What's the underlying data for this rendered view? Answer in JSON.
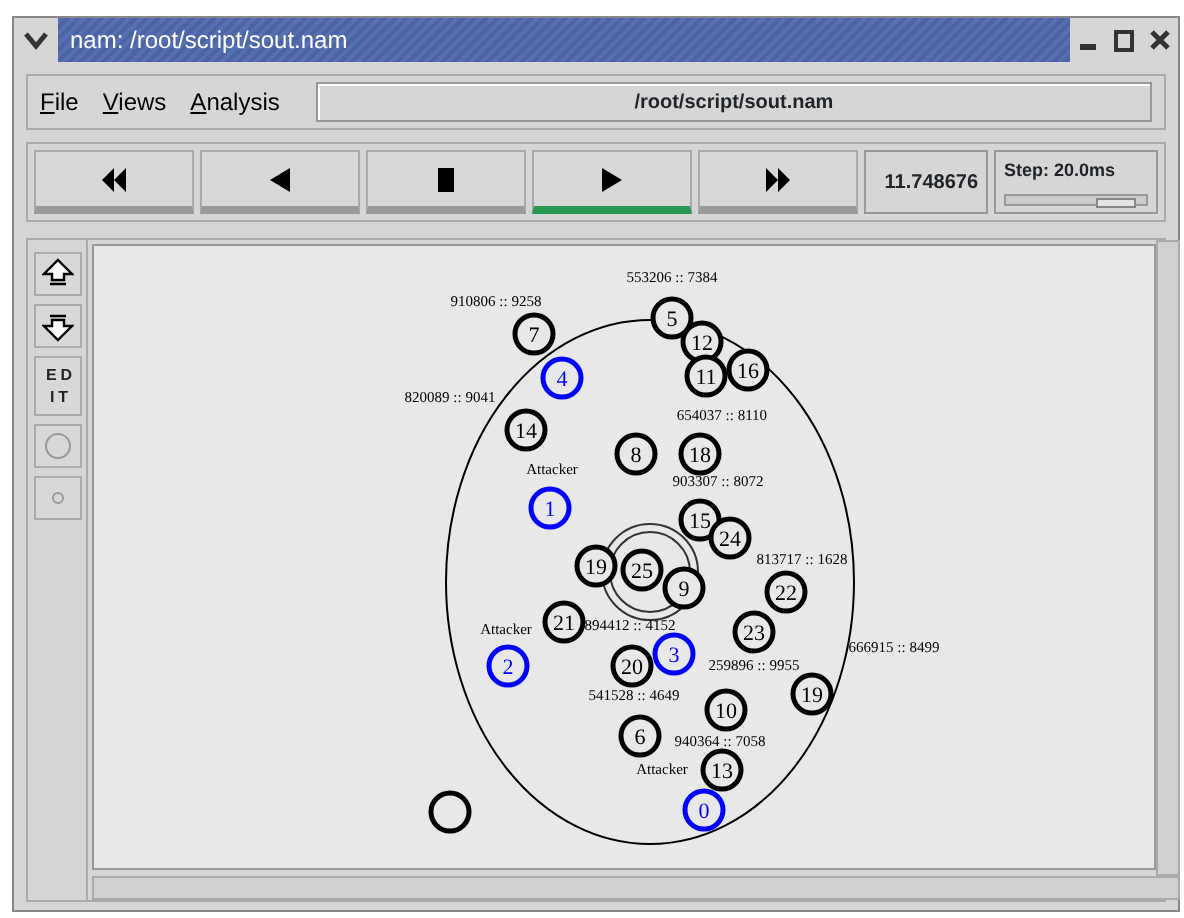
{
  "window": {
    "title": "nam: /root/script/sout.nam"
  },
  "menu": [
    "File",
    "Views",
    "Analysis"
  ],
  "path": "/root/script/sout.nam",
  "controls": [
    {
      "kind": "rewind",
      "selected": false
    },
    {
      "kind": "back",
      "selected": false
    },
    {
      "kind": "stop",
      "selected": false
    },
    {
      "kind": "play",
      "selected": true
    },
    {
      "kind": "forward",
      "selected": false
    }
  ],
  "time": "11.748676",
  "step": {
    "label": "Step: 20.0ms",
    "level": 0.78
  },
  "tools": [
    {
      "kind": "zoom-in"
    },
    {
      "kind": "zoom-out"
    },
    {
      "kind": "edit",
      "label": "EDIT"
    },
    {
      "kind": "circle"
    },
    {
      "kind": "dot"
    }
  ],
  "network": {
    "nodes": [
      {
        "label": "5",
        "color": "#000000"
      },
      {
        "label": "7",
        "color": "#000000"
      },
      {
        "label": "4",
        "color": "#0000ff"
      },
      {
        "label": "12",
        "color": "#000000"
      },
      {
        "label": "11",
        "color": "#000000"
      },
      {
        "label": "16",
        "color": "#000000"
      },
      {
        "label": "14",
        "color": "#000000"
      },
      {
        "label": "8",
        "color": "#000000"
      },
      {
        "label": "18",
        "color": "#000000"
      },
      {
        "label": "1",
        "color": "#0000ff"
      },
      {
        "label": "15",
        "color": "#000000"
      },
      {
        "label": "24",
        "color": "#000000"
      },
      {
        "label": "19",
        "color": "#000000"
      },
      {
        "label": "25",
        "color": "#000000"
      },
      {
        "label": "9",
        "color": "#000000"
      },
      {
        "label": "22",
        "color": "#000000"
      },
      {
        "label": "23",
        "color": "#000000"
      },
      {
        "label": "21",
        "color": "#000000"
      },
      {
        "label": "2",
        "color": "#0000ff"
      },
      {
        "label": "3",
        "color": "#0000ff"
      },
      {
        "label": "20",
        "color": "#000000"
      },
      {
        "label": "6",
        "color": "#000000"
      },
      {
        "label": "10",
        "color": "#000000"
      },
      {
        "label": "19",
        "color": "#000000"
      },
      {
        "label": "13",
        "color": "#000000"
      },
      {
        "label": "0",
        "color": "#0000ff"
      },
      {
        "color": "#000000"
      }
    ],
    "annotations": [
      "553206 :: 7384",
      "910806 :: 9258",
      "820089 :: 9041",
      "654037 :: 8110",
      "Attacker",
      "903307 :: 8072",
      "813717 :: 1628",
      "894412 :: 4152",
      "Attacker",
      "259896 :: 9955",
      "541528 :: 4649",
      "666915 :: 8499",
      "940364 :: 7058",
      "Attacker"
    ]
  }
}
